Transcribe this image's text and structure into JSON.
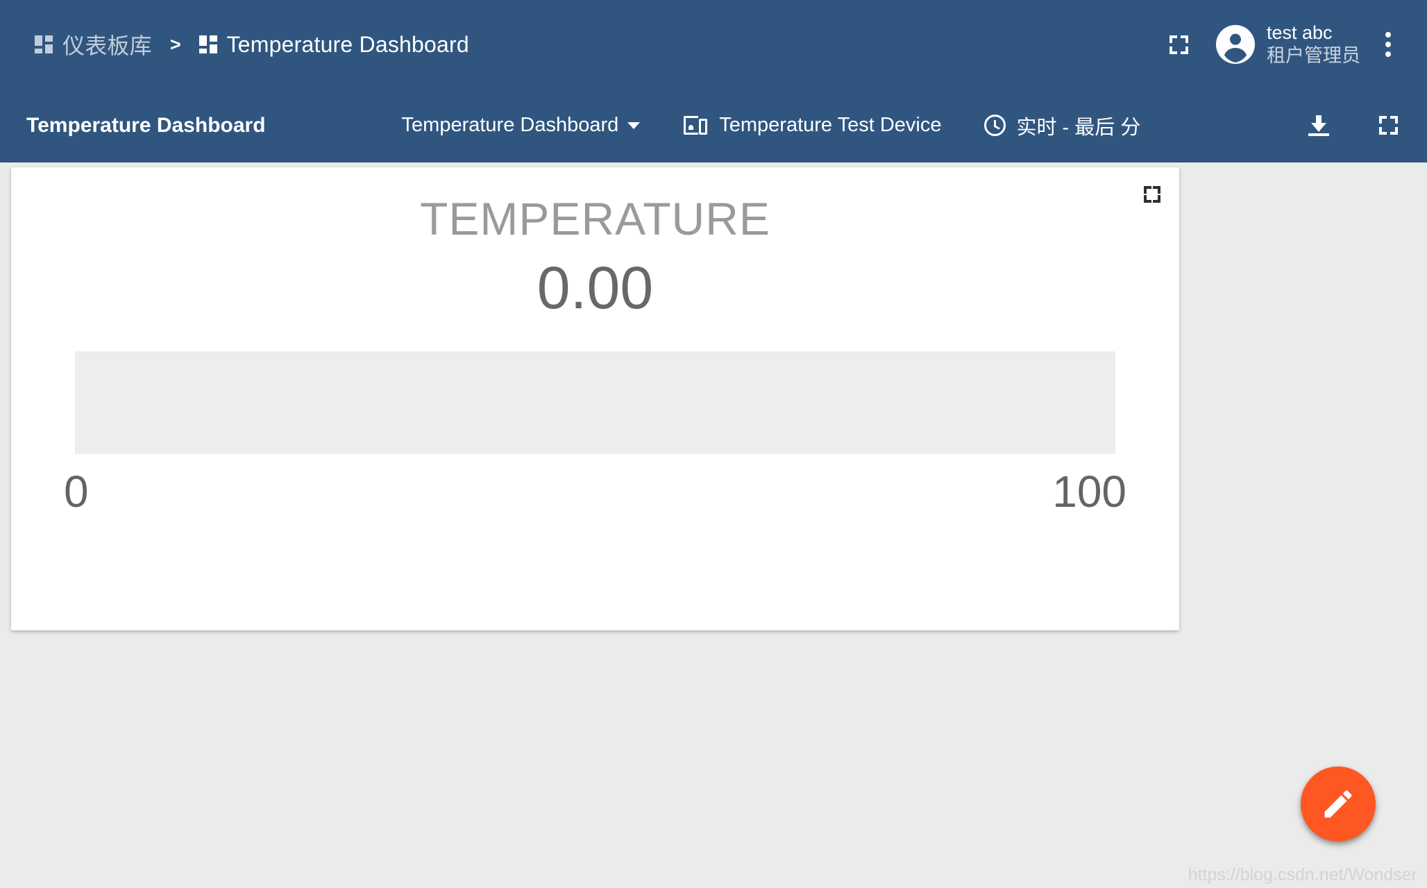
{
  "topbar": {
    "breadcrumb": [
      {
        "label": "仪表板库",
        "icon": "dashboards-grid-icon",
        "active": false
      },
      {
        "label": "Temperature Dashboard",
        "icon": "dashboard-grid-icon",
        "active": true
      }
    ],
    "separator": ">",
    "fullscreen_icon": "fullscreen-icon",
    "avatar_icon": "account-circle-icon",
    "user_name": "test abc",
    "user_role": "租户管理员",
    "more_icon": "more-vert-icon"
  },
  "dashboard_toolbar": {
    "title": "Temperature Dashboard",
    "state_selector": {
      "label": "Temperature Dashboard",
      "caret_icon": "chevron-down-icon"
    },
    "entity_alias": {
      "icon": "devices-other-icon",
      "label": "Temperature Test Device"
    },
    "timewindow": {
      "icon": "clock-icon",
      "label": "实时 - 最后 分"
    },
    "export_icon": "download-icon",
    "fullscreen_icon": "fullscreen-icon"
  },
  "widget": {
    "fullscreen_icon": "fullscreen-icon",
    "title": "TEMPERATURE",
    "value": "0.00",
    "min_label": "0",
    "max_label": "100"
  },
  "fab": {
    "icon": "edit-pencil-icon",
    "color": "#ff5722"
  },
  "watermark": "https://blog.csdn.net/Wondser",
  "colors": {
    "primary": "#305680",
    "page_background": "#ebebeb",
    "card_background": "#ffffff",
    "gauge_track": "#ededed",
    "gauge_title": "#9a9a9a",
    "gauge_value": "#686868",
    "accent": "#ff5722"
  },
  "chart_data": {
    "type": "bar",
    "title": "TEMPERATURE",
    "categories": [
      "temperature"
    ],
    "values": [
      0.0
    ],
    "value_label": "0.00",
    "xlabel": "",
    "ylabel": "",
    "ylim": [
      0,
      100
    ],
    "tick_labels": [
      "0",
      "100"
    ],
    "grid": false,
    "legend": "none",
    "orientation": "horizontal",
    "fill_percent": 0
  }
}
